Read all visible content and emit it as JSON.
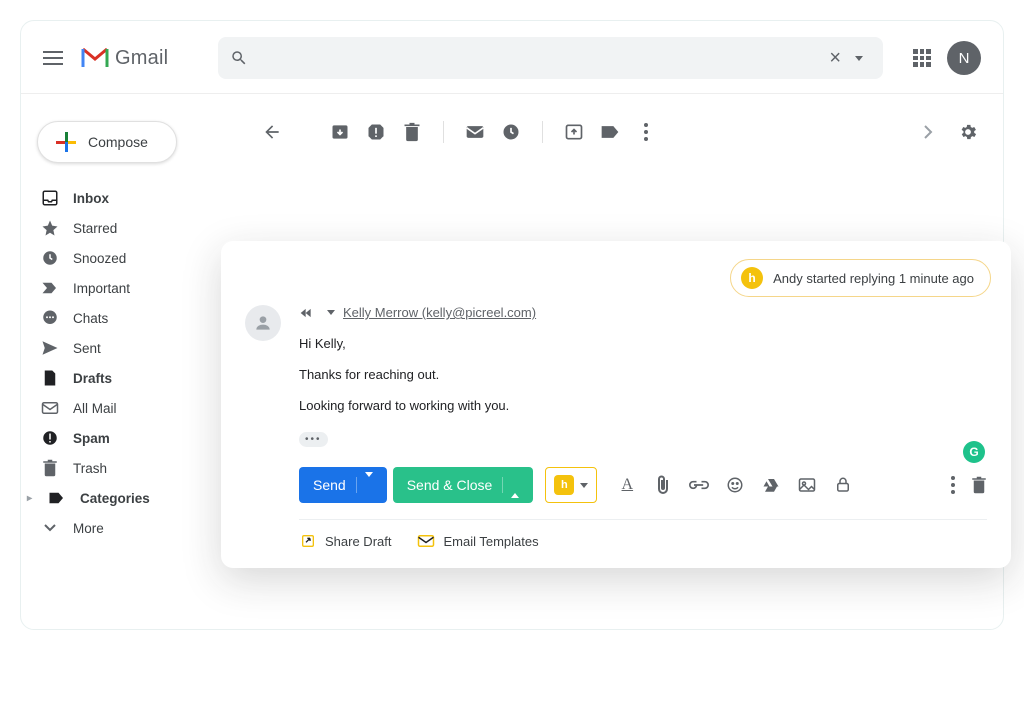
{
  "header": {
    "app_name": "Gmail",
    "avatar_initial": "N"
  },
  "sidebar": {
    "compose_label": "Compose",
    "items": [
      {
        "label": "Inbox",
        "bold": true
      },
      {
        "label": "Starred",
        "bold": false
      },
      {
        "label": "Snoozed",
        "bold": false
      },
      {
        "label": "Important",
        "bold": false
      },
      {
        "label": "Chats",
        "bold": false
      },
      {
        "label": "Sent",
        "bold": false
      },
      {
        "label": "Drafts",
        "bold": true
      },
      {
        "label": "All Mail",
        "bold": false
      },
      {
        "label": "Spam",
        "bold": true
      },
      {
        "label": "Trash",
        "bold": false
      },
      {
        "label": "Categories",
        "bold": true
      },
      {
        "label": "More",
        "bold": false
      }
    ]
  },
  "status_chip": {
    "text": "Andy started replying 1 minute ago"
  },
  "compose": {
    "to": "Kelly Merrow (kelly@picreel.com)",
    "body_line1": "Hi Kelly,",
    "body_line2": "Thanks for reaching out.",
    "body_line3": "Looking forward to working with you.",
    "send_label": "Send",
    "send_close_label": "Send & Close",
    "share_draft_label": "Share Draft",
    "email_templates_label": "Email Templates"
  }
}
